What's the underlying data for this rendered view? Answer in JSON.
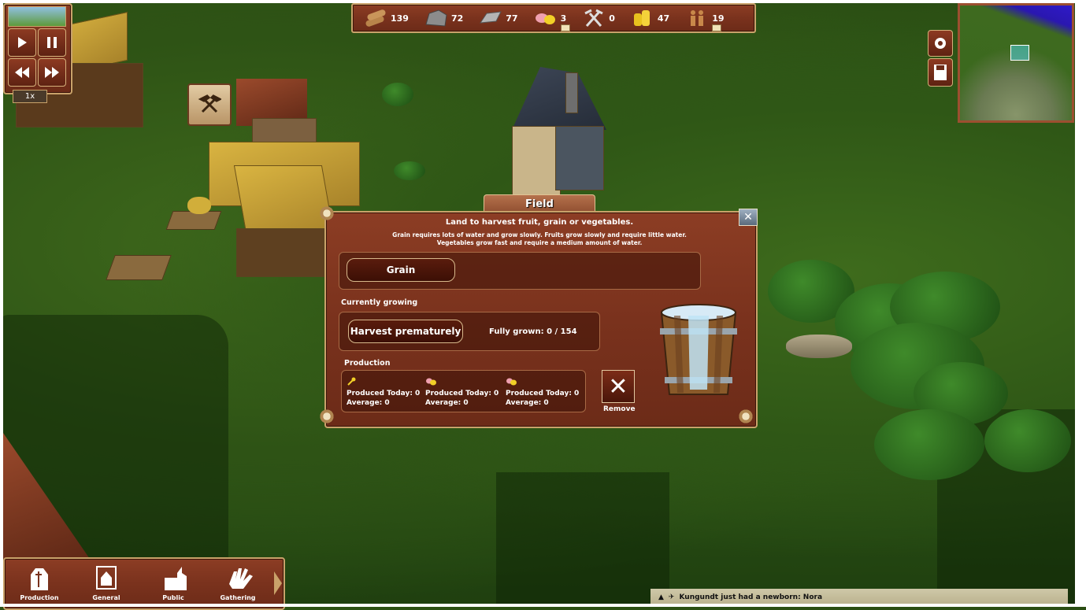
{
  "resources": [
    {
      "icon": "wood-log-icon",
      "value": "139",
      "mail": false
    },
    {
      "icon": "stone-icon",
      "value": "72",
      "mail": false
    },
    {
      "icon": "iron-bar-icon",
      "value": "77",
      "mail": false
    },
    {
      "icon": "food-icon",
      "value": "3",
      "mail": true
    },
    {
      "icon": "tools-icon",
      "value": "0",
      "mail": false
    },
    {
      "icon": "gold-coins-icon",
      "value": "47",
      "mail": false
    },
    {
      "icon": "population-icon",
      "value": "19",
      "mail": true
    }
  ],
  "speed": {
    "label": "1x"
  },
  "field_panel": {
    "title": "Field",
    "description_main": "Land to harvest fruit, grain or vegetables.",
    "description_line1": "Grain requires lots of water and grow slowly. Fruits grow slowly and require little water.",
    "description_line2": "Vegetables grow fast and require a medium amount of water.",
    "crop_selected": "Grain",
    "currently_growing_label": "Currently growing",
    "harvest_button": "Harvest prematurely",
    "fully_grown": "Fully grown: 0 / 154",
    "production_label": "Production",
    "production": [
      {
        "produced": "Produced Today: 0",
        "average": "Average: 0"
      },
      {
        "produced": "Produced Today: 0",
        "average": "Average: 0"
      },
      {
        "produced": "Produced Today: 0",
        "average": "Average: 0"
      }
    ],
    "remove_label": "Remove"
  },
  "bottom_menu": [
    {
      "label": "Production"
    },
    {
      "label": "General"
    },
    {
      "label": "Public"
    },
    {
      "label": "Gathering"
    }
  ],
  "notification": "Kungundt just had a newborn: Nora",
  "colors": {
    "wood": "#7a321d",
    "trim": "#c9a26a",
    "grass": "#35601a"
  }
}
